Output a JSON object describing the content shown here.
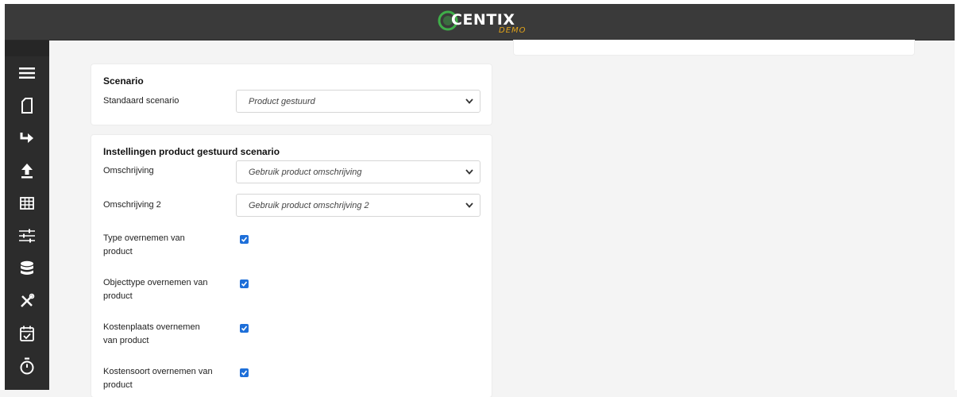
{
  "app": {
    "logo_text": "CENTIX",
    "logo_sub": "DEMO"
  },
  "sidebar": {
    "items": [
      {
        "icon": "menu-icon"
      },
      {
        "icon": "document-icon"
      },
      {
        "icon": "forward-arrow-icon"
      },
      {
        "icon": "upload-icon"
      },
      {
        "icon": "table-icon"
      },
      {
        "icon": "sliders-icon"
      },
      {
        "icon": "database-icon"
      },
      {
        "icon": "tools-icon"
      },
      {
        "icon": "calendar-check-icon"
      },
      {
        "icon": "stopwatch-icon"
      }
    ]
  },
  "scenario": {
    "title": "Scenario",
    "standard_label": "Standaard scenario",
    "standard_value": "Product gestuurd"
  },
  "product_settings": {
    "title": "Instellingen product gestuurd scenario",
    "description_label": "Omschrijving",
    "description_value": "Gebruik product omschrijving",
    "description2_label": "Omschrijving 2",
    "description2_value": "Gebruik product omschrijving 2",
    "checkboxes": [
      {
        "label": "Type overnemen van product",
        "checked": true
      },
      {
        "label": "Objecttype overnemen van product",
        "checked": true
      },
      {
        "label": "Kostenplaats overnemen van product",
        "checked": true
      },
      {
        "label": "Kostensoort overnemen van product",
        "checked": true
      }
    ]
  },
  "colors": {
    "topbar": "#3a3a3a",
    "sidebar": "#2c2c2c",
    "accent": "#1e6fd9",
    "logo_accent": "#e0a21a",
    "logo_ring": "#3fae49"
  }
}
